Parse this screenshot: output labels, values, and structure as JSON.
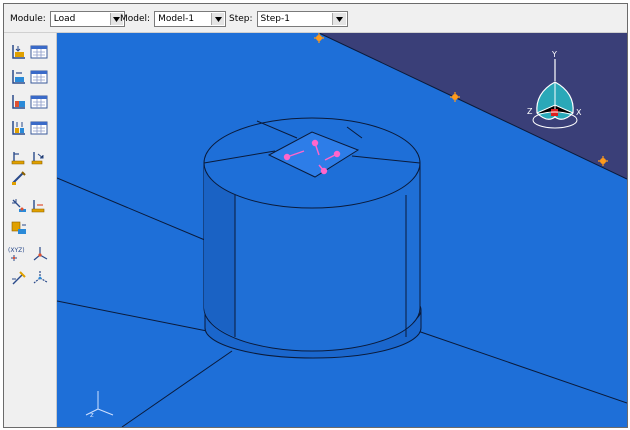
{
  "context_bar": {
    "module": {
      "label": "Module:",
      "value": "Load"
    },
    "model": {
      "label": "Model:",
      "value": "Model-1"
    },
    "step": {
      "label": "Step:",
      "value": "Step-1"
    }
  },
  "toolbox": {
    "tools": [
      "create-load-icon",
      "load-manager-icon",
      "create-bc-icon",
      "bc-manager-icon",
      "create-predefined-field-icon",
      "predefined-field-manager-icon",
      "create-load-case-icon",
      "load-case-manager-icon",
      "create-special-icon",
      "create-special-dropdown-icon",
      "edit-amplitude-icon",
      "create-constraint-icon",
      "create-interaction-icon",
      "create-connector-icon",
      "create-datum-csys-icon",
      "create-datum-point-icon",
      "create-datum-axis-icon",
      "create-datum-plane-icon"
    ],
    "csys_label": "(XYZ)"
  },
  "viewport": {
    "background_color": "#1e6fd8",
    "model_color": "#1e6fd8",
    "sky_color": "#3a3f78",
    "triad": {
      "y": "Y",
      "x": "X",
      "z": "Z"
    },
    "load_marker_color": "#ff9a1a",
    "load_arrow_color": "#ff66cc"
  }
}
